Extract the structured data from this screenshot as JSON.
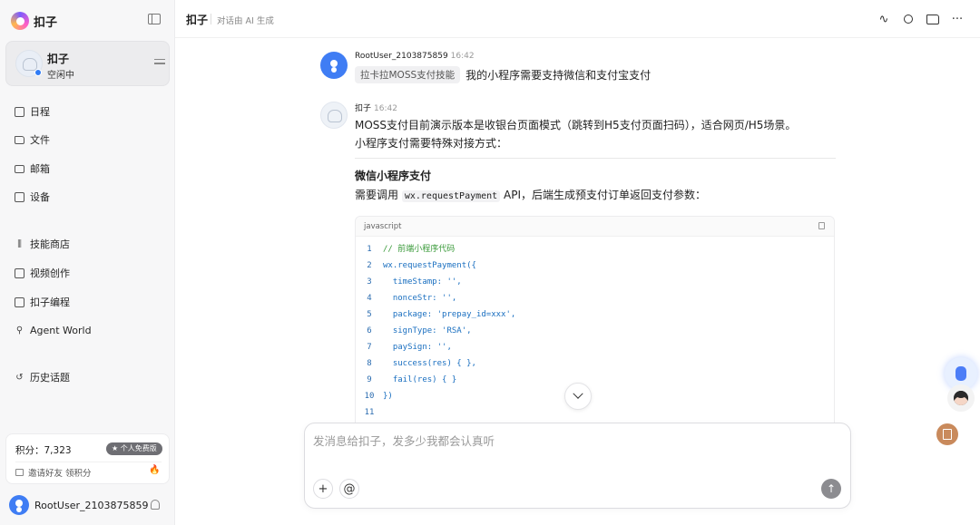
{
  "app": {
    "logo_text": "扣子"
  },
  "agent": {
    "name": "扣子",
    "status": "空闲中"
  },
  "nav": {
    "items": [
      {
        "label": "日程",
        "icon": "calendar-icon"
      },
      {
        "label": "文件",
        "icon": "folder-icon"
      },
      {
        "label": "邮箱",
        "icon": "mail-icon"
      },
      {
        "label": "设备",
        "icon": "device-icon"
      },
      {
        "label": "技能商店",
        "icon": "library-icon"
      },
      {
        "label": "视频创作",
        "icon": "video-icon"
      },
      {
        "label": "扣子编程",
        "icon": "code-icon"
      },
      {
        "label": "Agent World",
        "icon": "person-icon"
      },
      {
        "label": "历史话题",
        "icon": "history-icon"
      }
    ]
  },
  "points": {
    "label": "积分：7,323",
    "badge": "★ 个人免费版",
    "invite": "邀请好友 领积分"
  },
  "user": {
    "name": "RootUser_2103875859"
  },
  "topbar": {
    "title": "扣子",
    "subtitle": "对话由 AI 生成"
  },
  "messages": {
    "user_msg": {
      "name": "RootUser_2103875859",
      "time": "16:42",
      "skill_tag": "拉卡拉MOSS支付技能",
      "text": "我的小程序需要支持微信和支付宝支付"
    },
    "bot_msg": {
      "name": "扣子",
      "time": "16:42",
      "p1": "MOSS支付目前演示版本是收银台页面模式（跳转到H5支付页面扫码），适合网页/H5场景。",
      "p2": "小程序支付需要特殊对接方式：",
      "heading": "微信小程序支付",
      "p3_before": "需要调用",
      "p3_code": "wx.requestPayment",
      "p3_after": "API，后端生成预支付订单返回支付参数：",
      "code_lang": "javascript",
      "code_lines": [
        {
          "n": "1",
          "text": "// 前端小程序代码"
        },
        {
          "n": "2",
          "text": "wx.requestPayment({"
        },
        {
          "n": "3",
          "text": "  timeStamp: '', "
        },
        {
          "n": "4",
          "text": "  nonceStr: '', "
        },
        {
          "n": "5",
          "text": "  package: 'prepay_id=xxx',"
        },
        {
          "n": "6",
          "text": "  signType: 'RSA',"
        },
        {
          "n": "7",
          "text": "  paySign: '',"
        },
        {
          "n": "8",
          "text": "  success(res) { },"
        },
        {
          "n": "9",
          "text": "  fail(res) { }"
        },
        {
          "n": "10",
          "text": "})"
        },
        {
          "n": "11",
          "text": ""
        }
      ]
    }
  },
  "composer": {
    "placeholder": "发消息给扣子，发多少我都会认真听",
    "add": "+",
    "mention": "@",
    "send": "↑"
  },
  "colors": {
    "accent": "#3f7df4",
    "badge_bg": "#6e6e73"
  }
}
